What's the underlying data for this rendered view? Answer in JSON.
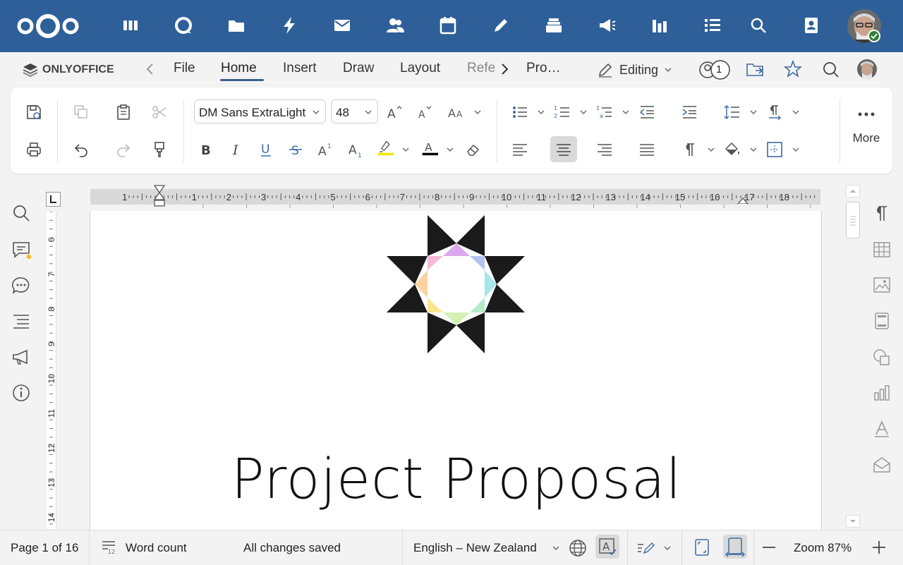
{
  "nextcloud": {
    "apps": [
      "dashboard-icon",
      "talk-icon",
      "files-icon",
      "activity-icon",
      "mail-icon",
      "contacts-icon",
      "calendar-icon",
      "notes-icon",
      "deck-icon",
      "announcements-icon",
      "analytics-icon",
      "tasks-icon"
    ],
    "search_icon": "search-icon",
    "contacts_menu_icon": "contacts-menu-icon"
  },
  "onlyoffice": {
    "brand": "ONLYOFFICE",
    "tabs": [
      {
        "label": "File"
      },
      {
        "label": "Home"
      },
      {
        "label": "Insert"
      },
      {
        "label": "Draw"
      },
      {
        "label": "Layout"
      },
      {
        "label": "Refe"
      },
      {
        "label": "Pro…"
      }
    ],
    "active_tab": "Home",
    "mode_label": "Editing",
    "users_count": "1"
  },
  "toolbar": {
    "font_name": "DM Sans ExtraLight",
    "font_size": "48",
    "more_label": "More",
    "highlight_color": "#f2e500",
    "font_color": "#000000"
  },
  "document": {
    "title_text": "Project Proposal",
    "ruler_numbers": [
      "1",
      "1",
      "2",
      "3",
      "4",
      "5",
      "6",
      "7",
      "8",
      "9",
      "10",
      "11",
      "12",
      "13",
      "14",
      "15",
      "16",
      "17",
      "18"
    ],
    "vruler_numbers": [
      "6",
      "7",
      "8",
      "9",
      "10",
      "11",
      "12",
      "13",
      "14"
    ]
  },
  "status": {
    "page_info": "Page 1 of 16",
    "word_count": "Word count",
    "save_state": "All changes saved",
    "language": "English – New Zealand",
    "zoom": "Zoom 87%"
  },
  "colors": {
    "nextcloud_blue": "#2e5f98",
    "accent": "#3d5f8f"
  }
}
